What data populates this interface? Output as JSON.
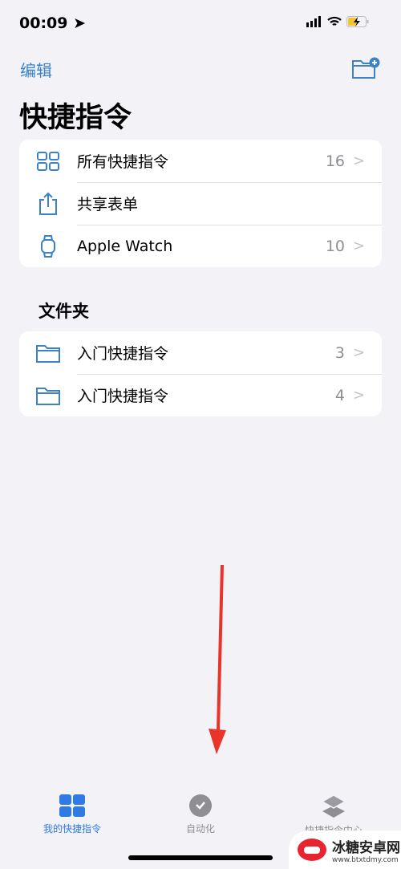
{
  "status": {
    "time": "00:09"
  },
  "nav": {
    "edit_label": "编辑",
    "title": "快捷指令"
  },
  "main_list": [
    {
      "icon": "grid-icon",
      "label": "所有快捷指令",
      "count": "16"
    },
    {
      "icon": "share-icon",
      "label": "共享表单",
      "count": ""
    },
    {
      "icon": "watch-icon",
      "label": "Apple Watch",
      "count": "10"
    }
  ],
  "folders_header": "文件夹",
  "folders": [
    {
      "label": "入门快捷指令",
      "count": "3"
    },
    {
      "label": "入门快捷指令",
      "count": "4"
    }
  ],
  "tabs": [
    {
      "label": "我的快捷指令",
      "active": true
    },
    {
      "label": "自动化",
      "active": false
    },
    {
      "label": "快捷指令中心",
      "active": false
    }
  ],
  "watermark": {
    "text": "冰糖安卓网",
    "url": "www.btxtdmy.com"
  },
  "colors": {
    "accent": "#3b82c6",
    "tab_active": "#2f7ae5",
    "tab_inactive": "#8e8e93",
    "annotation_arrow": "#e8342a"
  }
}
